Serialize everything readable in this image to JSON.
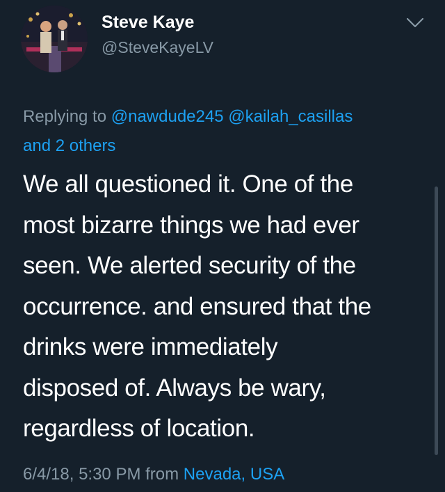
{
  "author": {
    "display_name": "Steve Kaye",
    "handle": "@SteveKayeLV"
  },
  "reply": {
    "prefix": "Replying to",
    "mention_1": "@nawdude245",
    "mention_2": "@kailah_casillas",
    "others": "and 2 others"
  },
  "tweet": {
    "lines": [
      "We all questioned it. One of the",
      "most bizarre things we had ever",
      "seen. We alerted security of the",
      "occurrence. and ensured that the",
      "drinks were immediately",
      "disposed of. Always be wary,",
      "regardless of location."
    ],
    "timestamp": "6/4/18, 5:30 PM",
    "from_label": "from",
    "location": "Nevada, USA"
  },
  "icons": {
    "menu": "chevron-down-icon"
  },
  "colors": {
    "background": "#15202b",
    "text": "#ffffff",
    "secondary": "#8899a6",
    "accent": "#1da1f2"
  }
}
